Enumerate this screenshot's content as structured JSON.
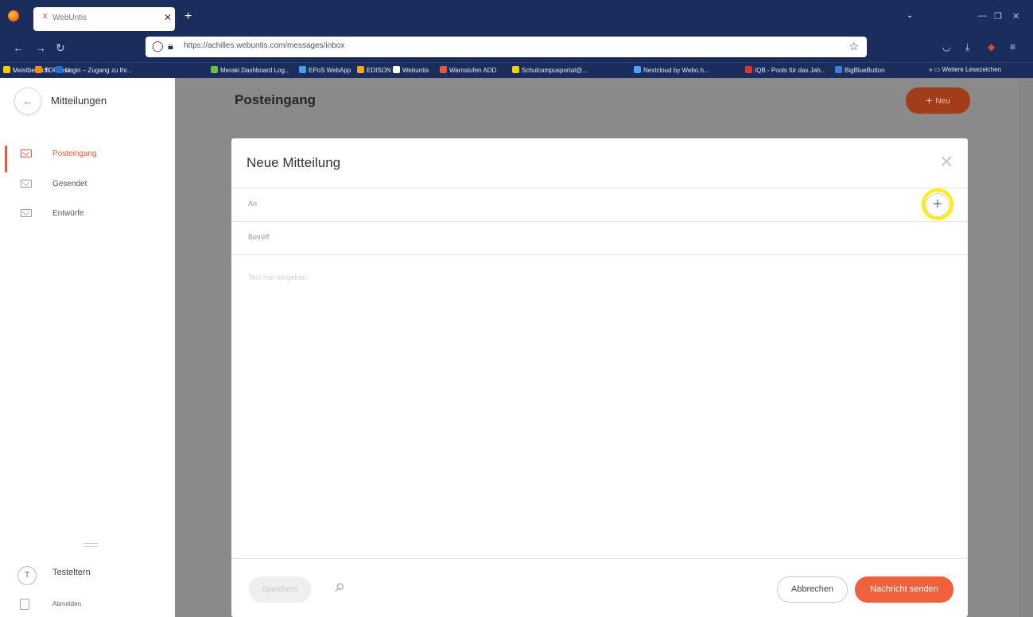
{
  "browser": {
    "tab_title": "WebUntis",
    "tab_favicon": "x",
    "url": "https://achilles.webuntis.com/messages/inbox",
    "bookmarks": [
      {
        "label": "Meistbesucht",
        "color": "#ffcc00"
      },
      {
        "label": "TOPdesk",
        "color": "#ff8a00"
      },
      {
        "label": "Login – Zugang zu Ihr...",
        "color": "#1e6fd9"
      },
      {
        "label": "Meraki Dashboard Log...",
        "color": "#6cc04a"
      },
      {
        "label": "EPoS WebApp",
        "color": "#4a9fe0"
      },
      {
        "label": "EDISON",
        "color": "#f5a623"
      },
      {
        "label": "Webuntis",
        "color": "#ffffff"
      },
      {
        "label": "Warnstufen ADD",
        "color": "#e8573b"
      },
      {
        "label": "Schulcampusportal@...",
        "color": "#f5d000"
      },
      {
        "label": "Nextcloud by Webo.h...",
        "color": "#4aa3ff"
      },
      {
        "label": "IQB - Pools für das Jah...",
        "color": "#d33"
      },
      {
        "label": "BigBlueButton",
        "color": "#3b7fd8"
      }
    ],
    "more_bookmarks": "Weitere Lesezeichen"
  },
  "sidebar": {
    "title": "Mitteilungen",
    "items": [
      {
        "label": "Posteingang",
        "active": true
      },
      {
        "label": "Gesendet",
        "active": false
      },
      {
        "label": "Entwürfe",
        "active": false
      }
    ],
    "user": {
      "initial": "T",
      "name": "Testeltern"
    },
    "logout": "Abmelden"
  },
  "main": {
    "title": "Posteingang",
    "new_button": "Neu"
  },
  "modal": {
    "title": "Neue Mitteilung",
    "to_label": "An",
    "subject_label": "Betreff",
    "body_placeholder": "Text hier eingeben",
    "save_button": "Speichern",
    "cancel_button": "Abbrechen",
    "send_button": "Nachricht senden"
  },
  "colors": {
    "accent": "#f0623d",
    "browser_chrome": "#1a2d5c",
    "highlight": "#ffee00"
  }
}
